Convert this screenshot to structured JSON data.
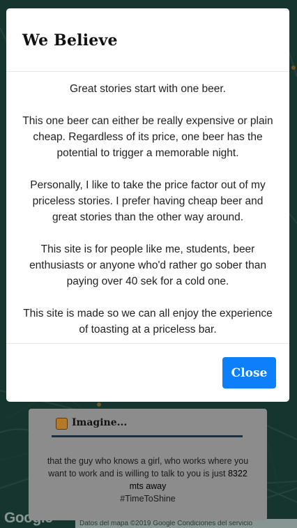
{
  "modal": {
    "title": "We Believe",
    "paragraphs": [
      "Great stories start with one beer.",
      "This one beer can either be really expensive or plain cheap. Regardless of its price, one beer has the potential to trigger a memorable night.",
      "Personally, I like to take the price factor out of my priceless stories. I prefer having cheap beer and great stories than the other way around.",
      "This site is for people like me, students, beer enthusiasts or anyone who'd rather go sober than paying over 40 sek for a cold one.",
      "This site is made so we can all enjoy the experience of toasting at a priceless bar."
    ],
    "close_label": "Close"
  },
  "imagine": {
    "title": "Imagine...",
    "icon": "beer-mug-icon",
    "text_before": "that the guy who knows a girl, who works where you want to work and is willing to talk to you is just ",
    "distance": "8322 mts away",
    "hashtag": "#TimeToShine"
  },
  "map": {
    "logo": "Google",
    "attribution": "Datos del mapa ©2019 Google   Condiciones del servicio"
  },
  "colors": {
    "close_button": "#0d7ffb",
    "map_base": "#2a6a5c"
  }
}
